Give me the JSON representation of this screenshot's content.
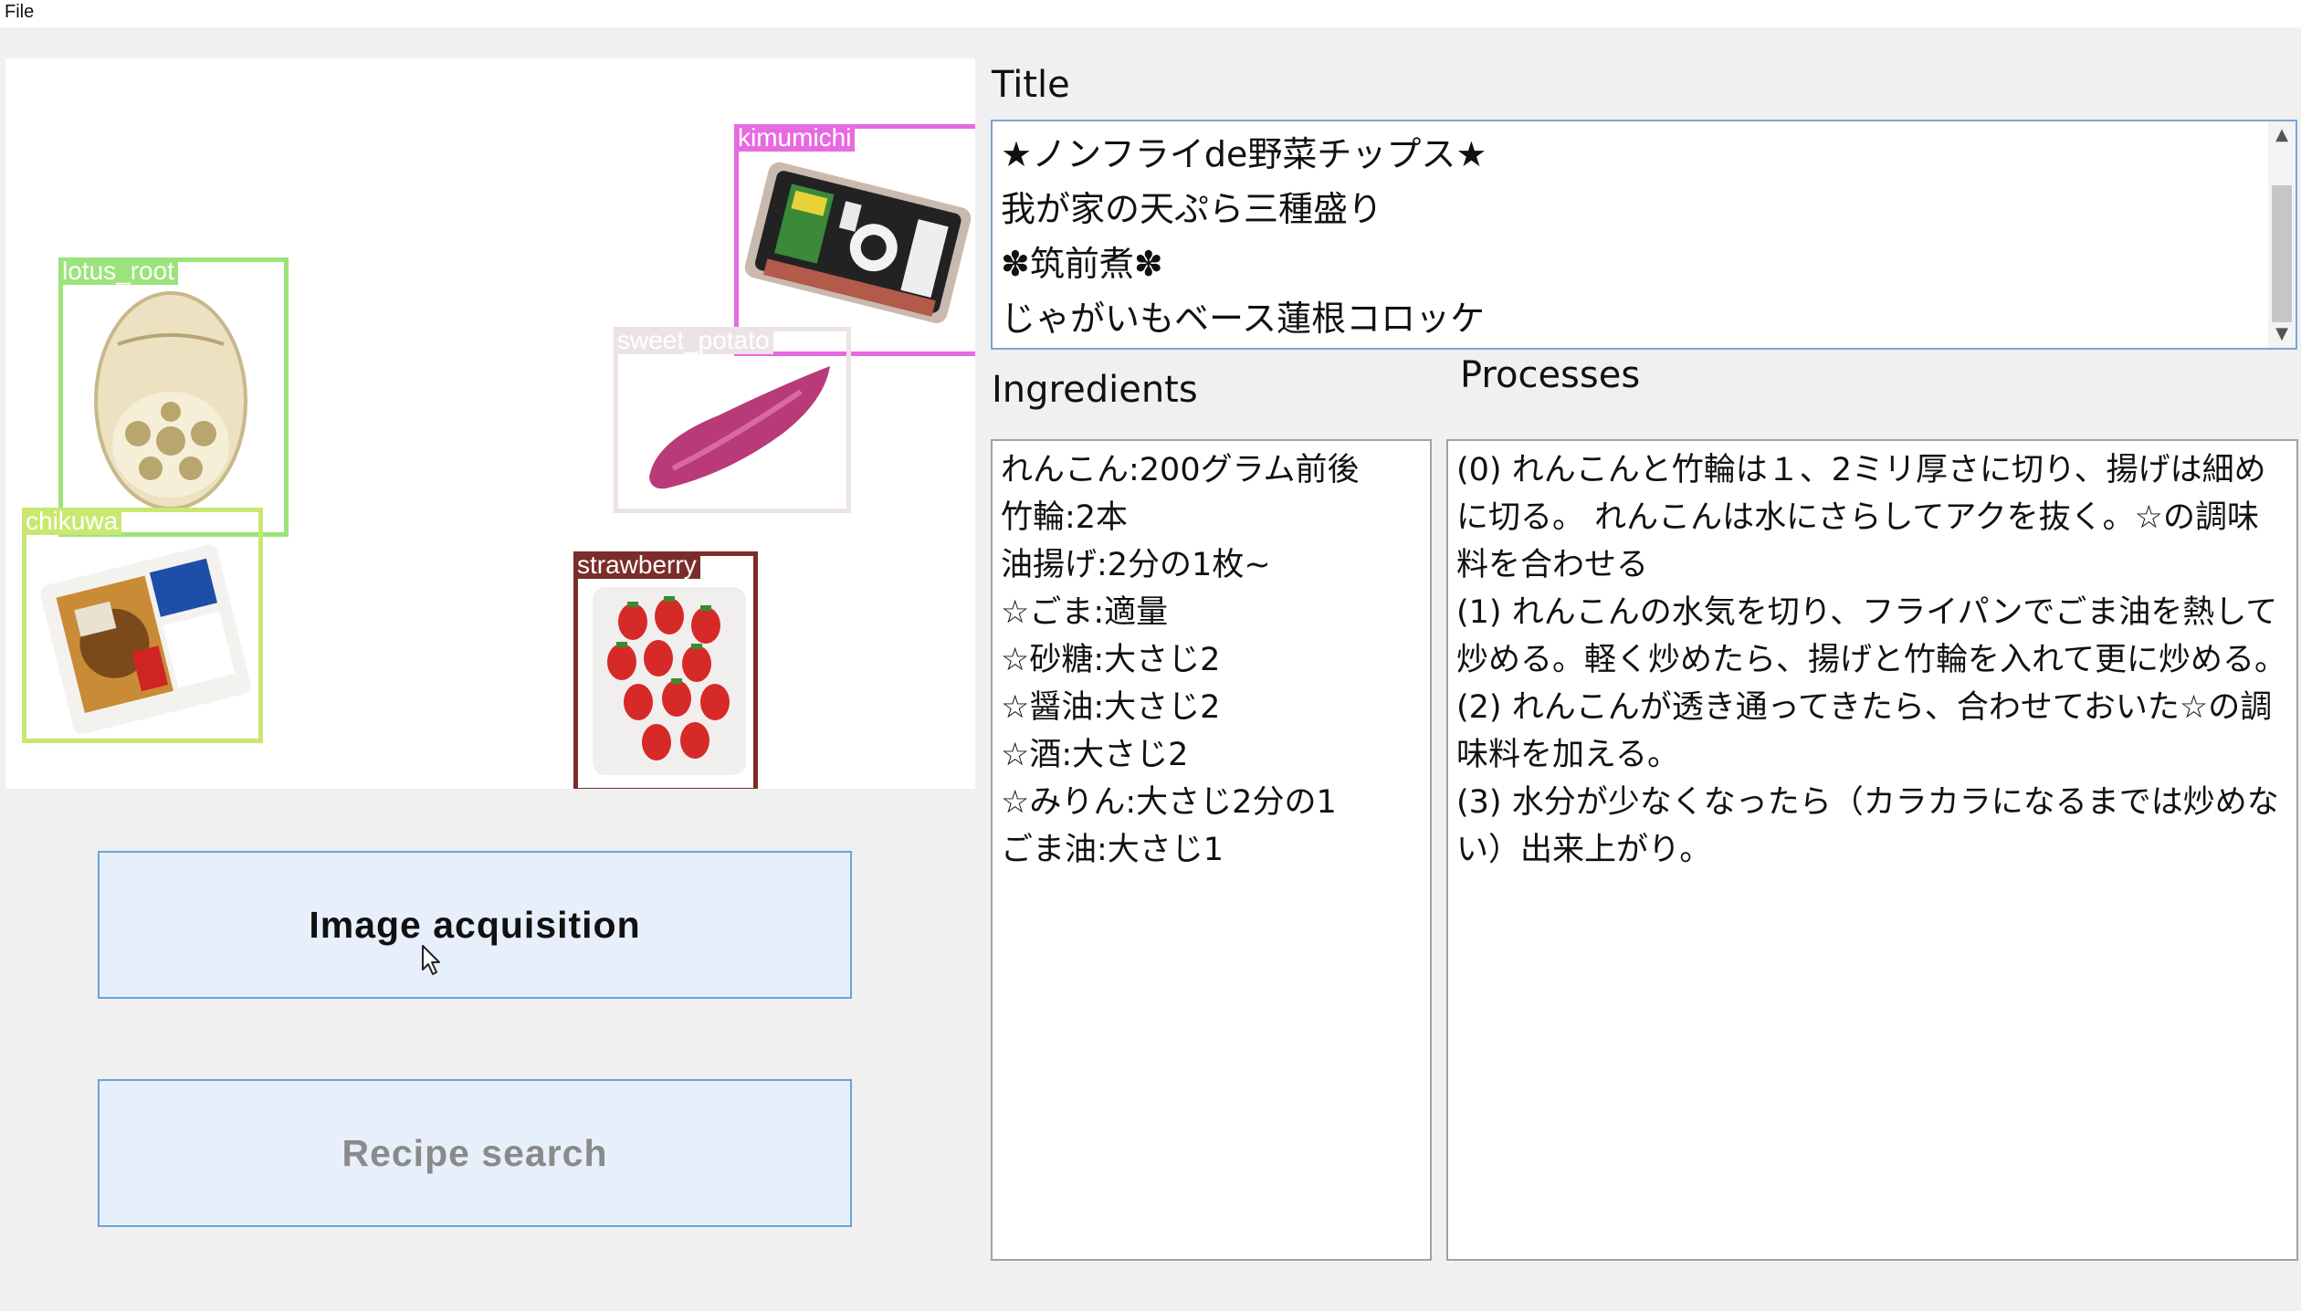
{
  "menubar": {
    "file_label": "File"
  },
  "detections": [
    {
      "label": "kimumichi",
      "color": "#e76ae0"
    },
    {
      "label": "lotus_root",
      "color": "#9be37b"
    },
    {
      "label": "sweet_potato",
      "color": "#ece3e5"
    },
    {
      "label": "chikuwa",
      "color": "#c9e86f"
    },
    {
      "label": "strawberry",
      "color": "#7a2d2a"
    }
  ],
  "buttons": {
    "image_acquisition": "Image acquisition",
    "recipe_search": "Recipe search"
  },
  "title_section": {
    "label": "Title",
    "items": [
      "★ノンフライde野菜チップス★",
      "我が家の天ぷら三種盛り",
      "✽筑前煮✽",
      "じゃがいもベース蓮根コロッケ"
    ]
  },
  "ingredients_section": {
    "label": "Ingredients",
    "items": [
      "れんこん:200グラム前後",
      "竹輪:2本",
      "油揚げ:2分の1枚~",
      "☆ごま:適量",
      "☆砂糖:大さじ2",
      "☆醤油:大さじ2",
      "☆酒:大さじ2",
      "☆みりん:大さじ2分の1",
      "ごま油:大さじ1"
    ]
  },
  "processes_section": {
    "label": "Processes",
    "items": [
      "(0) れんこんと竹輪は１、2ミリ厚さに切り、揚げは細めに切る。 れんこんは水にさらしてアクを抜く。☆の調味料を合わせる",
      "(1) れんこんの水気を切り、フライパンでごま油を熱して炒める。軽く炒めたら、揚げと竹輪を入れて更に炒める。",
      "(2) れんこんが透き通ってきたら、合わせておいた☆の調味料を加える。",
      "(3) 水分が少なくなったら（カラカラになるまでは炒めない）出来上がり。"
    ]
  }
}
